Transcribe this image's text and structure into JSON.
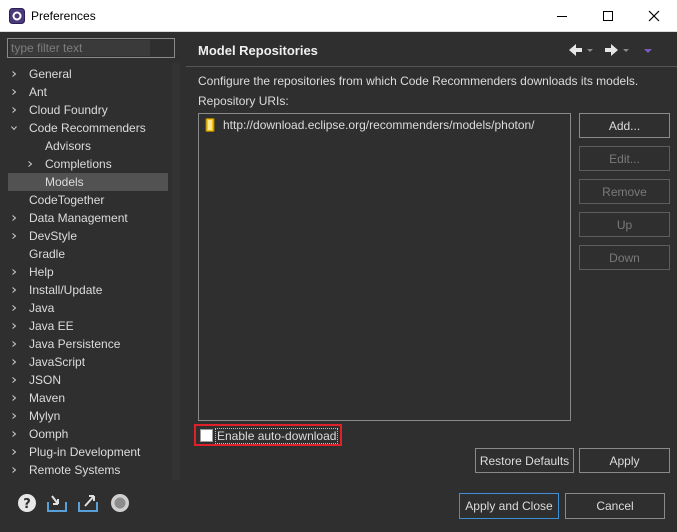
{
  "window": {
    "title": "Preferences"
  },
  "filter": {
    "placeholder": "type filter text"
  },
  "tree": {
    "items": [
      {
        "label": "General",
        "expandable": true,
        "expanded": false,
        "level": 0
      },
      {
        "label": "Ant",
        "expandable": true,
        "expanded": false,
        "level": 0
      },
      {
        "label": "Cloud Foundry",
        "expandable": true,
        "expanded": false,
        "level": 0
      },
      {
        "label": "Code Recommenders",
        "expandable": true,
        "expanded": true,
        "level": 0
      },
      {
        "label": "Advisors",
        "expandable": false,
        "level": 1
      },
      {
        "label": "Completions",
        "expandable": true,
        "expanded": false,
        "level": 1
      },
      {
        "label": "Models",
        "expandable": false,
        "level": 1,
        "selected": true
      },
      {
        "label": "CodeTogether",
        "expandable": false,
        "level": 0
      },
      {
        "label": "Data Management",
        "expandable": true,
        "expanded": false,
        "level": 0
      },
      {
        "label": "DevStyle",
        "expandable": true,
        "expanded": false,
        "level": 0
      },
      {
        "label": "Gradle",
        "expandable": false,
        "level": 0
      },
      {
        "label": "Help",
        "expandable": true,
        "expanded": false,
        "level": 0
      },
      {
        "label": "Install/Update",
        "expandable": true,
        "expanded": false,
        "level": 0
      },
      {
        "label": "Java",
        "expandable": true,
        "expanded": false,
        "level": 0
      },
      {
        "label": "Java EE",
        "expandable": true,
        "expanded": false,
        "level": 0
      },
      {
        "label": "Java Persistence",
        "expandable": true,
        "expanded": false,
        "level": 0
      },
      {
        "label": "JavaScript",
        "expandable": true,
        "expanded": false,
        "level": 0
      },
      {
        "label": "JSON",
        "expandable": true,
        "expanded": false,
        "level": 0
      },
      {
        "label": "Maven",
        "expandable": true,
        "expanded": false,
        "level": 0
      },
      {
        "label": "Mylyn",
        "expandable": true,
        "expanded": false,
        "level": 0
      },
      {
        "label": "Oomph",
        "expandable": true,
        "expanded": false,
        "level": 0
      },
      {
        "label": "Plug-in Development",
        "expandable": true,
        "expanded": false,
        "level": 0
      },
      {
        "label": "Remote Systems",
        "expandable": true,
        "expanded": false,
        "level": 0
      }
    ]
  },
  "page": {
    "title": "Model Repositories",
    "description": "Configure the repositories from which Code Recommenders downloads its models.",
    "uri_label": "Repository URIs:",
    "uris": [
      "http://download.eclipse.org/recommenders/models/photon/"
    ],
    "buttons": {
      "add": "Add...",
      "edit": "Edit...",
      "remove": "Remove",
      "up": "Up",
      "down": "Down"
    },
    "auto_download_label": "Enable auto-download",
    "auto_download_checked": false,
    "restore_defaults": "Restore Defaults",
    "apply": "Apply"
  },
  "footer": {
    "apply_and_close": "Apply and Close",
    "cancel": "Cancel"
  },
  "colors": {
    "background": "#2f2f2f",
    "highlight": "#e0202a",
    "selection": "#525252",
    "focus": "#3f8fd6"
  }
}
